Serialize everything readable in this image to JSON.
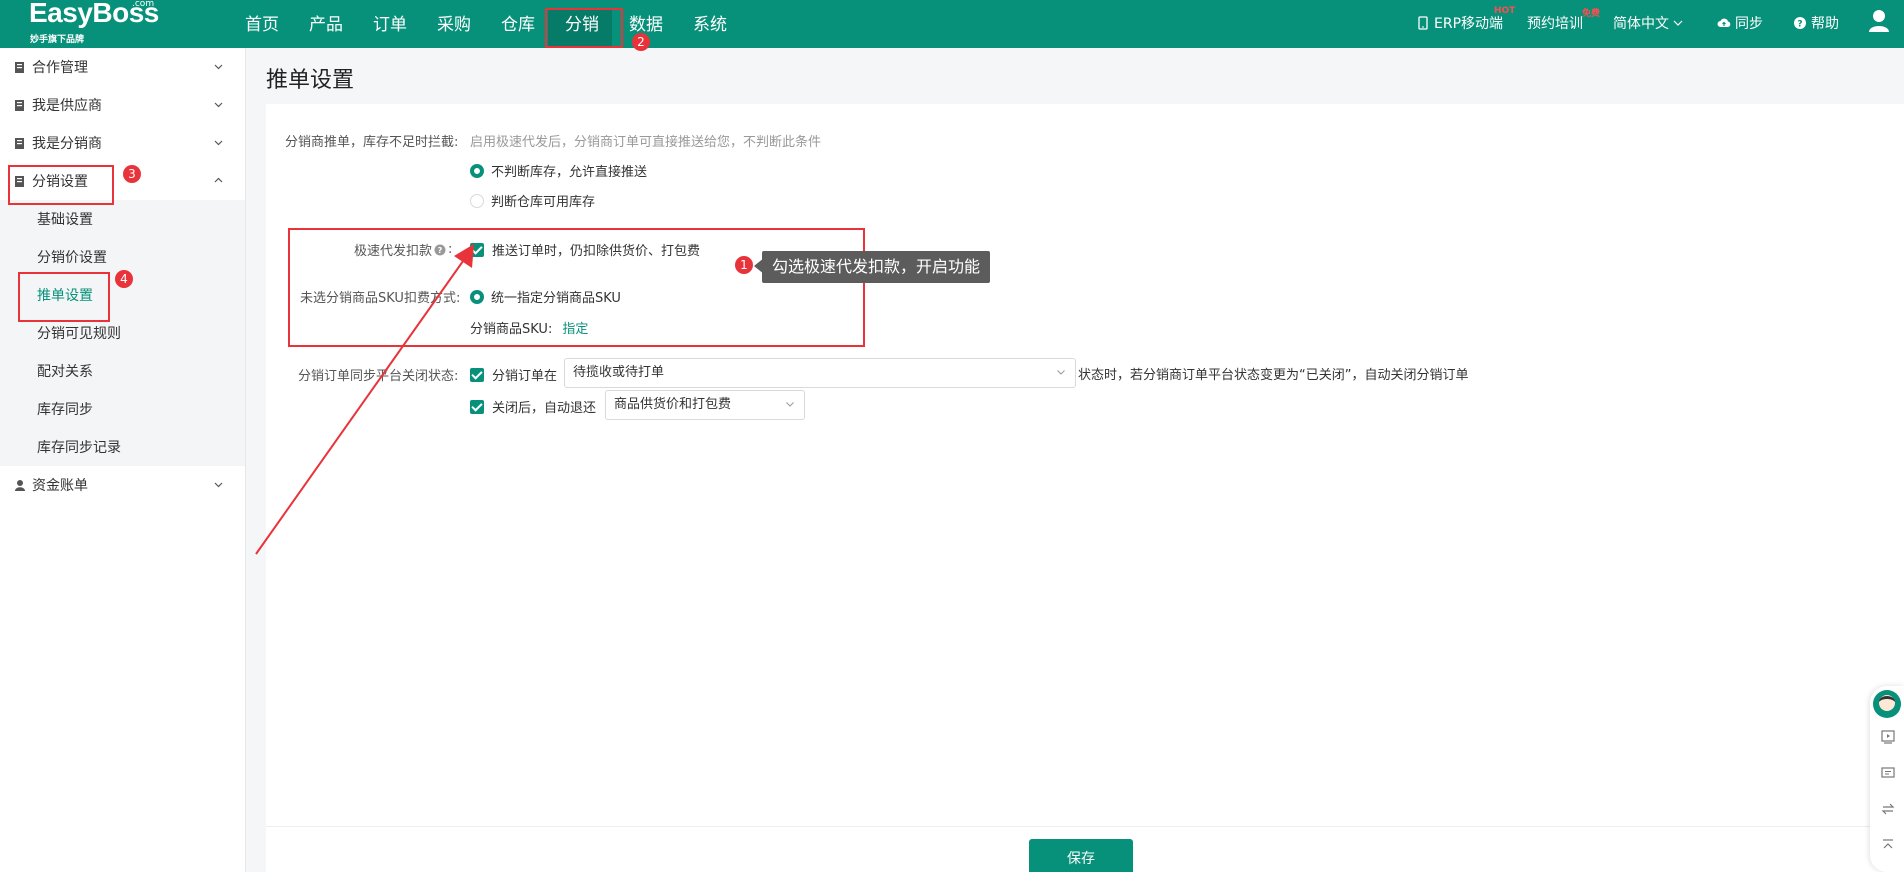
{
  "brand": {
    "name": "EasyBoss",
    "com": ".com",
    "subtitle": "妙手旗下品牌"
  },
  "nav": {
    "items": [
      "首页",
      "产品",
      "订单",
      "采购",
      "仓库",
      "分销",
      "数据",
      "系统"
    ],
    "active": "分销"
  },
  "right_nav": {
    "erp": "ERP移动端",
    "erp_badge": "HOT",
    "training": "预约培训",
    "training_badge": "免费",
    "language": "简体中文",
    "sync": "同步",
    "help": "帮助"
  },
  "sidebar": {
    "groups": [
      {
        "label": "合作管理"
      },
      {
        "label": "我是供应商"
      },
      {
        "label": "我是分销商"
      },
      {
        "label": "分销设置"
      },
      {
        "label": "资金账单"
      }
    ],
    "sub_items": [
      "基础设置",
      "分销价设置",
      "推单设置",
      "分销可见规则",
      "配对关系",
      "库存同步",
      "库存同步记录"
    ],
    "active_sub": "推单设置"
  },
  "page": {
    "title": "推单设置"
  },
  "form": {
    "stock_label": "分销商推单，库存不足时拦截:",
    "stock_hint": "启用极速代发后，分销商订单可直接推送给您，不判断此条件",
    "stock_options": [
      "不判断库存，允许直接推送",
      "判断仓库可用库存"
    ],
    "stock_selected": "不判断库存，允许直接推送",
    "fast_label": "极速代发扣款",
    "fast_help_icon": "question-circle-icon",
    "fast_colon": ":",
    "fast_checkbox": "推送订单时，仍扣除供货价、打包费",
    "fast_checked": true,
    "sku_label": "未选分销商品SKU扣费方式:",
    "sku_option": "统一指定分销商品SKU",
    "sku_field_label": "分销商品SKU:",
    "sku_link": "指定",
    "close_label": "分销订单同步平台关闭状态:",
    "close_check1": "分销订单在",
    "close_select1": "待揽收或待打单",
    "close_suffix": "状态时，若分销商订单平台状态变更为“已关闭”，自动关闭分销订单",
    "close_check2": "关闭后，自动退还",
    "close_select2": "商品供货价和打包费"
  },
  "annotations": {
    "tooltip": "勾选极速代发扣款，开启功能",
    "badges": [
      "1",
      "2",
      "3",
      "4"
    ]
  },
  "footer": {
    "save": "保存"
  },
  "colors": {
    "primary": "#07917a",
    "annotation": "#e8333a"
  }
}
